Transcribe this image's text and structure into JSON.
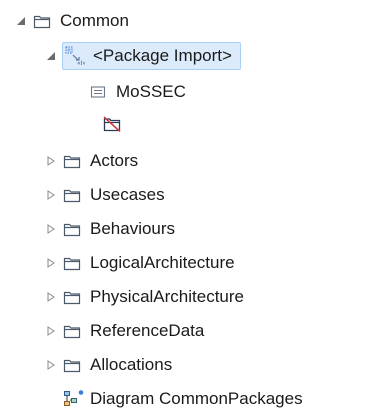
{
  "tree": {
    "root": {
      "label": "Common",
      "icon": "folder-icon",
      "expanded": true
    },
    "package_import": {
      "label": "<Package Import>",
      "icon": "package-import-icon",
      "expanded": true,
      "selected": true
    },
    "mossec": {
      "label": "MoSSEC",
      "icon": "model-element-icon"
    },
    "unnamed_import": {
      "icon": "unresolved-folder-icon"
    },
    "folders": [
      {
        "label": "Actors"
      },
      {
        "label": "Usecases"
      },
      {
        "label": "Behaviours"
      },
      {
        "label": "LogicalArchitecture"
      },
      {
        "label": "PhysicalArchitecture"
      },
      {
        "label": "ReferenceData"
      },
      {
        "label": "Allocations"
      }
    ],
    "diagram": {
      "label": "Diagram CommonPackages",
      "icon": "diagram-icon"
    }
  },
  "colors": {
    "folder_stroke": "#4a5a6a",
    "selection_bg": "#dcebfc",
    "selection_border": "#a9cdf5",
    "twisty": "#6b6b6b"
  }
}
